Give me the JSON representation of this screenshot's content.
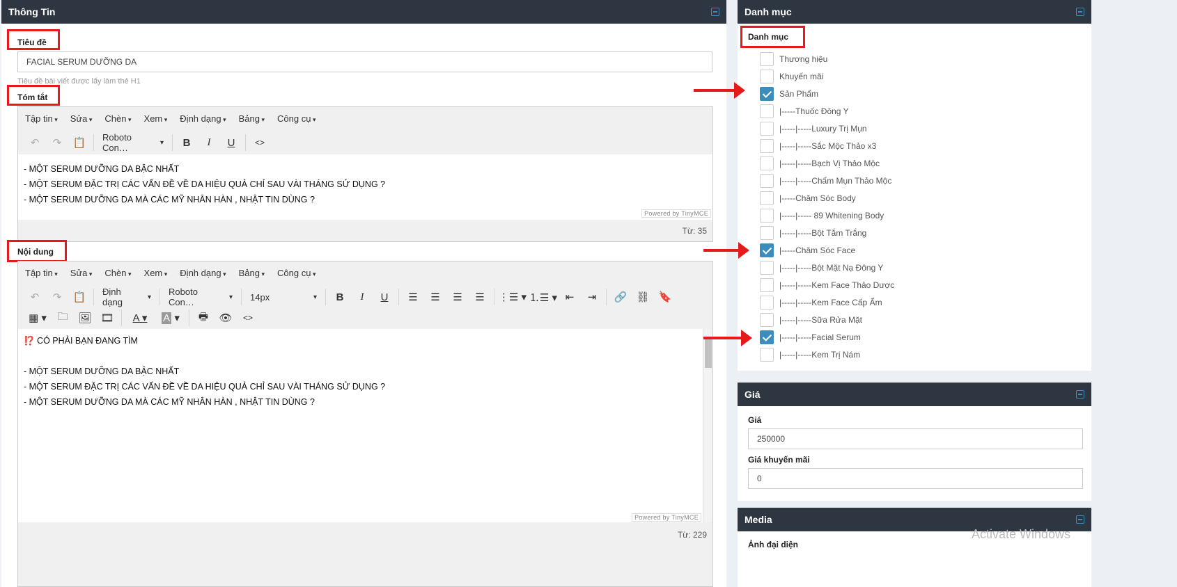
{
  "info_panel": {
    "title": "Thông Tin",
    "title_field": {
      "label": "Tiêu đề",
      "value": "FACIAL SERUM DƯỠNG DA",
      "help": "Tiêu đề bài viết được lấy làm thẻ H1"
    },
    "summary": {
      "label": "Tóm tắt",
      "menu": [
        "Tập tin",
        "Sửa",
        "Chèn",
        "Xem",
        "Định dạng",
        "Bảng",
        "Công cụ"
      ],
      "font_select": "Roboto Con…",
      "lines": [
        " - MỘT SERUM DƯỠNG DA BẬC NHẤT",
        "- MỘT SERUM ĐẶC TRỊ CÁC VẤN ĐỀ VỀ DA HIỆU QUẢ CHỈ SAU VÀI THÁNG SỬ DỤNG ?",
        "- MỘT SERUM DƯỠNG DA MÀ CÁC MỸ NHÂN HÀN , NHẬT TIN DÙNG ?"
      ],
      "powered": "Powered by TinyMCE",
      "word_count": "Từ: 35"
    },
    "content": {
      "label": "Nội dung",
      "menu": [
        "Tập tin",
        "Sửa",
        "Chèn",
        "Xem",
        "Định dạng",
        "Bảng",
        "Công cụ"
      ],
      "format_select": "Định dạng",
      "font_select": "Roboto Con…",
      "size_select": "14px",
      "lines": [
        "⁉️ CÓ PHẢI BẠN ĐANG TÌM",
        "",
        "- MỘT SERUM DƯỠNG DA BẬC NHẤT",
        "- MỘT SERUM ĐẶC TRỊ CÁC VẤN ĐỀ VỀ DA HIỆU QUẢ CHỈ SAU VÀI THÁNG SỬ DỤNG ?",
        "- MỘT SERUM DƯỠNG DA MÀ CÁC MỸ NHÂN HÀN , NHẬT TIN DÙNG ?"
      ],
      "powered": "Powered by TinyMCE",
      "word_count": "Từ: 229"
    }
  },
  "category_panel": {
    "title": "Danh mục",
    "label": "Danh mục",
    "items": [
      {
        "label": "Thương hiệu",
        "checked": false
      },
      {
        "label": "Khuyến mãi",
        "checked": false
      },
      {
        "label": "Sản Phẩm",
        "checked": true
      },
      {
        "label": "|-----Thuốc Đông Y",
        "checked": false
      },
      {
        "label": "|-----|-----Luxury Trị Mụn",
        "checked": false
      },
      {
        "label": "|-----|-----Sắc Mộc Thảo x3",
        "checked": false
      },
      {
        "label": "|-----|-----Bạch Vị Thảo Mộc",
        "checked": false
      },
      {
        "label": "|-----|-----Chấm Mụn Thảo Mộc",
        "checked": false
      },
      {
        "label": "|-----Chăm Sóc Body",
        "checked": false
      },
      {
        "label": "|-----|----- 89 Whitening Body",
        "checked": false
      },
      {
        "label": "|-----|-----Bột Tắm Trắng",
        "checked": false
      },
      {
        "label": "|-----Chăm Sóc Face",
        "checked": true
      },
      {
        "label": "|-----|-----Bột Mặt Nạ Đông Y",
        "checked": false
      },
      {
        "label": "|-----|-----Kem Face Thảo Dược",
        "checked": false
      },
      {
        "label": "|-----|-----Kem Face Cấp Ẩm",
        "checked": false
      },
      {
        "label": "|-----|-----Sữa Rửa Mặt",
        "checked": false
      },
      {
        "label": "|-----|-----Facial Serum",
        "checked": true
      },
      {
        "label": "|-----|-----Kem Trị Nám",
        "checked": false
      }
    ]
  },
  "price_panel": {
    "title": "Giá",
    "price_label": "Giá",
    "price_value": "250000",
    "sale_label": "Giá khuyến mãi",
    "sale_value": "0"
  },
  "media_panel": {
    "title": "Media",
    "avatar_label": "Ảnh đại diện"
  },
  "watermark": "Activate Windows",
  "colors": {
    "header": "#2e3641",
    "accent": "#3c8dbc",
    "annotation": "#e61a1a"
  }
}
